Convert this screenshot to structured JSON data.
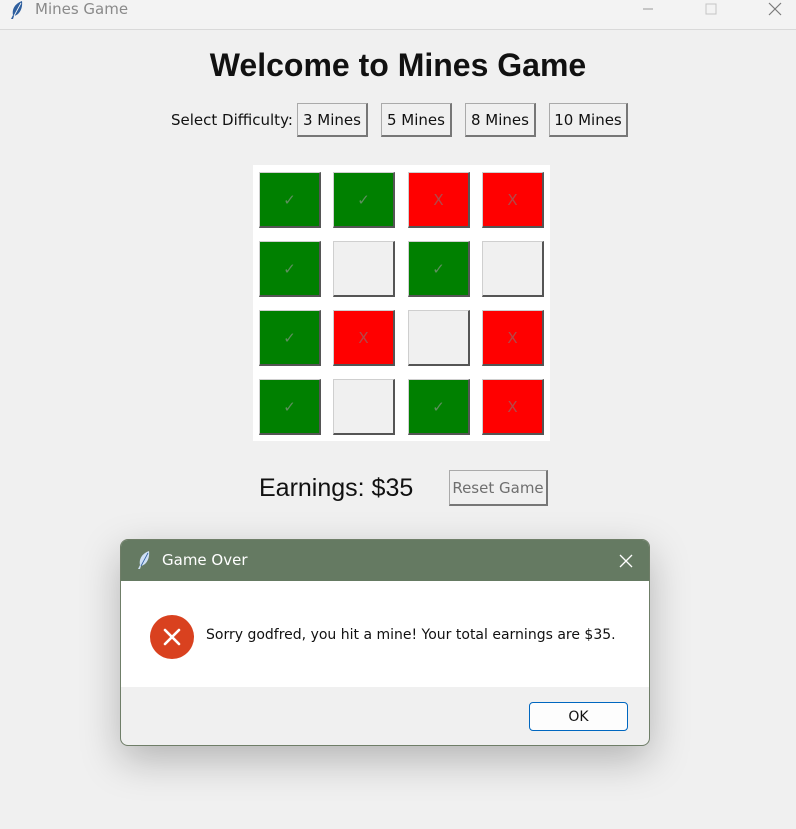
{
  "window": {
    "title": "Mines Game"
  },
  "heading": "Welcome to Mines Game",
  "difficulty": {
    "label": "Select Difficulty:",
    "options": [
      "3 Mines",
      "5 Mines",
      "8 Mines",
      "10 Mines"
    ]
  },
  "board": {
    "rows": [
      [
        {
          "state": "safe",
          "symbol": "✓"
        },
        {
          "state": "safe",
          "symbol": "✓"
        },
        {
          "state": "mine",
          "symbol": "X"
        },
        {
          "state": "mine",
          "symbol": "X"
        }
      ],
      [
        {
          "state": "safe",
          "symbol": "✓"
        },
        {
          "state": "hidden",
          "symbol": ""
        },
        {
          "state": "safe",
          "symbol": "✓"
        },
        {
          "state": "hidden",
          "symbol": ""
        }
      ],
      [
        {
          "state": "safe",
          "symbol": "✓"
        },
        {
          "state": "mine",
          "symbol": "X"
        },
        {
          "state": "hidden",
          "symbol": ""
        },
        {
          "state": "mine",
          "symbol": "X"
        }
      ],
      [
        {
          "state": "safe",
          "symbol": "✓"
        },
        {
          "state": "hidden",
          "symbol": ""
        },
        {
          "state": "safe",
          "symbol": "✓"
        },
        {
          "state": "mine",
          "symbol": "X"
        }
      ]
    ]
  },
  "earnings_text": "Earnings: $35",
  "reset_label": "Reset Game",
  "dialog": {
    "title": "Game Over",
    "message": "Sorry godfred, you hit a mine! Your total earnings are $35.",
    "ok_label": "OK",
    "icon": "error-icon"
  },
  "colors": {
    "safe": "#008000",
    "mine": "#ff0000",
    "hidden": "#f0f0f0",
    "dialog_titlebar": "#657a62",
    "error": "#d9411f"
  }
}
